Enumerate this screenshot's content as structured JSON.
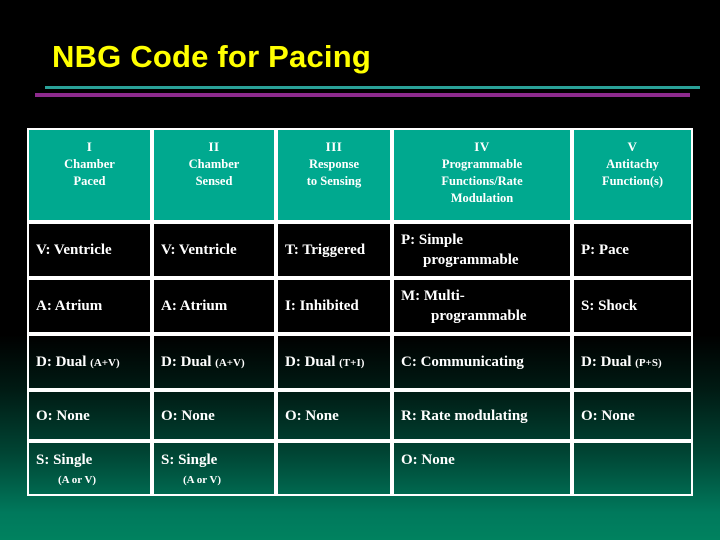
{
  "slide": {
    "title": "NBG Code for Pacing",
    "title_color": "#ffff00",
    "rule_teal_color": "#2aa198",
    "rule_purple_color": "#8d2a8d",
    "header_bg_color": "#00a98f",
    "background": "black-to-teal gradient"
  },
  "table": {
    "headers": [
      {
        "roman": "I",
        "line1": "Chamber",
        "line2": "Paced",
        "line3": "",
        "line4": ""
      },
      {
        "roman": "II",
        "line1": "Chamber",
        "line2": "Sensed",
        "line3": "",
        "line4": ""
      },
      {
        "roman": "III",
        "line1": "Response",
        "line2": "to Sensing",
        "line3": "",
        "line4": ""
      },
      {
        "roman": "IV",
        "line1": "Programmable",
        "line2": "Functions/Rate",
        "line3": "Modulation",
        "line4": ""
      },
      {
        "roman": "V",
        "line1": "Antitachy",
        "line2": "Function(s)",
        "line3": "",
        "line4": ""
      }
    ],
    "rows": [
      {
        "c1": {
          "main": "V: Ventricle",
          "sub": "",
          "cont": ""
        },
        "c2": {
          "main": "V: Ventricle",
          "sub": "",
          "cont": ""
        },
        "c3": {
          "main": "T: Triggered",
          "sub": "",
          "cont": ""
        },
        "c4": {
          "main": "P: Simple",
          "sub": "",
          "cont": "programmable"
        },
        "c5": {
          "main": "P: Pace",
          "sub": "",
          "cont": ""
        }
      },
      {
        "c1": {
          "main": "A: Atrium",
          "sub": "",
          "cont": ""
        },
        "c2": {
          "main": "A: Atrium",
          "sub": "",
          "cont": ""
        },
        "c3": {
          "main": "I: Inhibited",
          "sub": "",
          "cont": ""
        },
        "c4": {
          "main": "M: Multi-",
          "sub": "",
          "cont": "programmable"
        },
        "c5": {
          "main": "S: Shock",
          "sub": "",
          "cont": ""
        }
      },
      {
        "c1": {
          "main": "D: Dual ",
          "sub": "(A+V)",
          "cont": ""
        },
        "c2": {
          "main": "D: Dual ",
          "sub": "(A+V)",
          "cont": ""
        },
        "c3": {
          "main": "D: Dual ",
          "sub": "(T+I)",
          "cont": ""
        },
        "c4": {
          "main": "C: Communicating",
          "sub": "",
          "cont": ""
        },
        "c5": {
          "main": "D: Dual ",
          "sub": "(P+S)",
          "cont": ""
        }
      },
      {
        "c1": {
          "main": "O: None",
          "sub": "",
          "cont": ""
        },
        "c2": {
          "main": "O: None",
          "sub": "",
          "cont": ""
        },
        "c3": {
          "main": "O: None",
          "sub": "",
          "cont": ""
        },
        "c4": {
          "main": "R: Rate modulating",
          "sub": "",
          "cont": ""
        },
        "c5": {
          "main": "O: None",
          "sub": "",
          "cont": ""
        }
      },
      {
        "c1": {
          "main": "S: Single",
          "sub": "(A or V)",
          "cont": ""
        },
        "c2": {
          "main": "S: Single",
          "sub": "(A or V)",
          "cont": ""
        },
        "c3": {
          "main": "",
          "sub": "",
          "cont": ""
        },
        "c4": {
          "main": "O:  None",
          "sub": "",
          "cont": ""
        },
        "c5": {
          "main": "",
          "sub": "",
          "cont": ""
        }
      }
    ]
  }
}
